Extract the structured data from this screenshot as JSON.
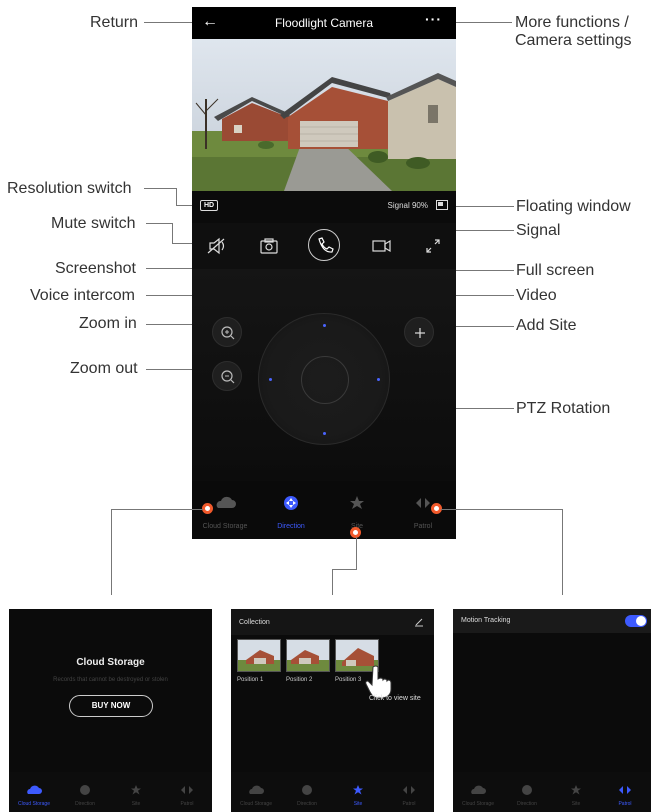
{
  "app": {
    "title": "Floodlight Camera",
    "signal_text": "Signal",
    "signal_value": "90%",
    "hd_label": "HD"
  },
  "callouts": {
    "return": "Return",
    "more_functions_line1": "More functions /",
    "more_functions_line2": "Camera settings",
    "resolution_switch": "Resolution switch",
    "floating_window": "Floating window",
    "mute_switch": "Mute switch",
    "signal": "Signal",
    "screenshot": "Screenshot",
    "full_screen": "Full screen",
    "voice_intercom": "Voice intercom",
    "video": "Video",
    "zoom_in": "Zoom in",
    "add_site": "Add Site",
    "zoom_out": "Zoom out",
    "ptz_rotation": "PTZ Rotation"
  },
  "tabs": [
    {
      "label": "Cloud Storage",
      "icon": "cloud-icon"
    },
    {
      "label": "Direction",
      "icon": "direction-icon"
    },
    {
      "label": "Site",
      "icon": "star-icon"
    },
    {
      "label": "Patrol",
      "icon": "patrol-icon"
    }
  ],
  "cloud_panel": {
    "title": "Cloud Storage",
    "subtitle": "Records that cannot be destroyed or stolen",
    "button": "BUY NOW"
  },
  "site_panel": {
    "title": "Collection",
    "positions": [
      "Position 1",
      "Position 2",
      "Position 3"
    ],
    "hint": "Click to view site"
  },
  "patrol_panel": {
    "title": "Motion Tracking",
    "toggle_on": true
  },
  "colors": {
    "accent": "#3d5afe",
    "marker": "#f25a2c",
    "background": "#000000"
  }
}
